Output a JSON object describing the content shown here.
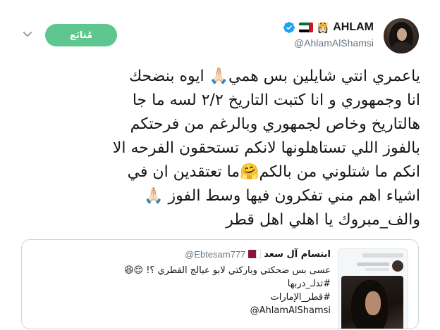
{
  "author": {
    "name": "AHLAM",
    "handle": "@AhlamAlShamsi",
    "name_emoji": "👸🏻",
    "avatar_icon": "profile-photo"
  },
  "follow_button": {
    "label": "مُتابَع"
  },
  "tweet": {
    "lines": [
      "ياعمري انتي شايلين بس همي🙏🏻 ايوه بنضحك",
      "انا وجمهوري و انا كتبت التاريخ ٢/٢ لسه ما جا",
      "هالتاريخ وخاص لجمهوري وبالرغم من فرحتكم",
      "بالفوز اللي تستاهلونها لانكم تستحقون الفرحه الا",
      "انكم ما شتلوني من بالكم🤗ما تعتقدين ان في",
      "اشياء اهم مني تفكرون فيها وسط الفوز 🙏🏻",
      "والف_مبروك يا اهلي اهل قطر"
    ]
  },
  "quoted": {
    "name": "ابتسام آل  سعد",
    "handle": "@Ebtesam777",
    "lines": [
      "عسى بس ضحكتي وباركتي لابو عيالج القطري ؟! 😌😆"
    ],
    "hashtags": [
      "#تدلـ_دربها",
      "#قطر_الإمارات"
    ],
    "mention": "@AhlamAlShamsi"
  },
  "colors": {
    "follow_bg": "#5ec68f",
    "verified": "#1da1f2",
    "secondary_text": "#657786",
    "border": "#ccd6dd"
  },
  "icons": [
    "chevron-down-icon",
    "verified-badge-icon",
    "uae-flag-icon",
    "qatar-flag-icon"
  ]
}
